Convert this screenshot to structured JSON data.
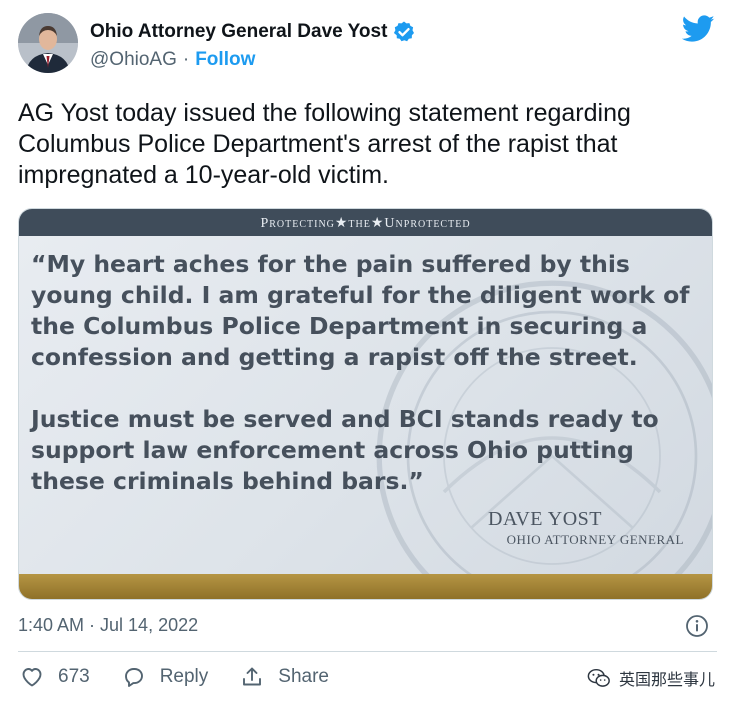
{
  "author": {
    "name": "Ohio Attorney General Dave Yost",
    "handle": "@OhioAG",
    "separator": "·",
    "follow_label": "Follow",
    "verified": true
  },
  "tweet": {
    "text": "AG Yost today issued the following statement regarding Columbus Police Department's arrest of the rapist that impregnated a 10-year-old victim."
  },
  "card": {
    "header": "Protecting★the★Unprotected",
    "quote_paragraph_1": "“My heart aches for the pain suffered by this young child. I am grateful for the diligent work of the Columbus Police Department in securing a confession and getting a rapist off the street.",
    "quote_paragraph_2": "Justice must be served and BCI stands ready to support law enforcement across Ohio putting these criminals behind bars.”",
    "signature_name": "DAVE YOST",
    "signature_title": "OHIO ATTORNEY GENERAL"
  },
  "meta": {
    "timestamp": "1:40 AM · Jul 14, 2022"
  },
  "actions": {
    "like_count": "673",
    "reply_label": "Reply",
    "share_label": "Share"
  },
  "watermark": {
    "text": "英国那些事儿"
  },
  "colors": {
    "accent": "#1d9bf0",
    "header_bar": "#3f4c5a",
    "gold_bar": "#a8893a"
  }
}
